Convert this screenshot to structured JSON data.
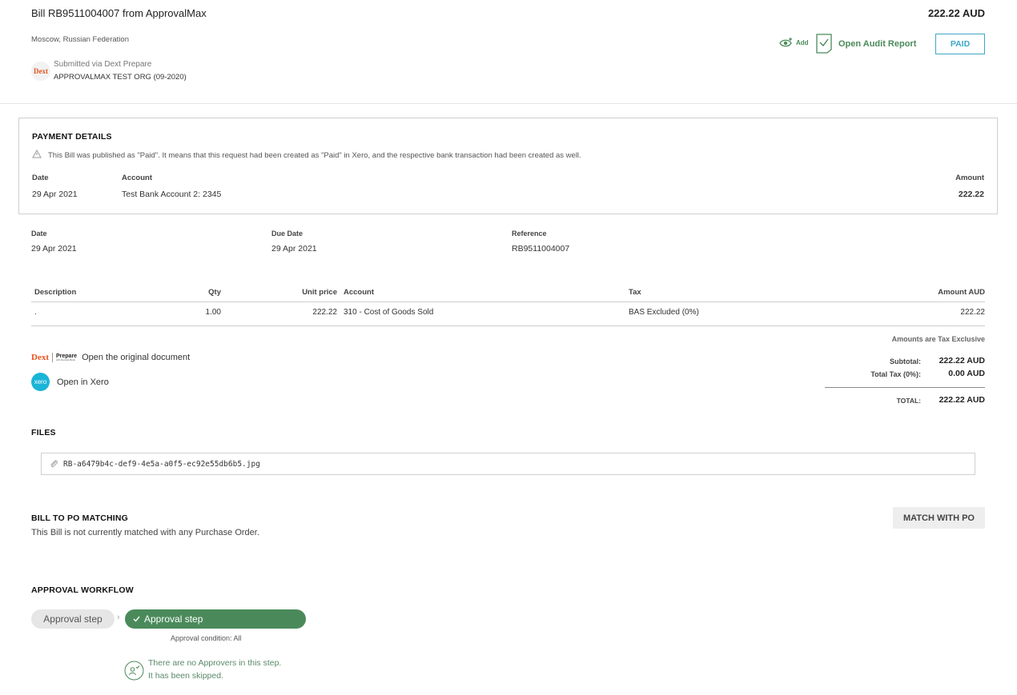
{
  "header": {
    "title": "Bill RB9511004007 from ApprovalMax",
    "total": "222.22 AUD",
    "location": "Moscow, Russian Federation",
    "submitted_via": "Submitted via Dext Prepare",
    "org": "APPROVALMAX TEST ORG (09-2020)",
    "dext_logo_text": "Dext",
    "add_label": "Add",
    "audit_label": "Open Audit Report",
    "status_button": "PAID"
  },
  "payment": {
    "heading": "PAYMENT DETAILS",
    "notice": "This Bill was published as \"Paid\". It means that this request had been created as \"Paid\" in Xero, and the respective bank transaction had been created as well.",
    "date_label": "Date",
    "account_label": "Account",
    "amount_label": "Amount",
    "date": "29 Apr 2021",
    "account": "Test Bank Account 2: 2345",
    "amount": "222.22"
  },
  "details": {
    "date_label": "Date",
    "date": "29 Apr 2021",
    "due_label": "Due Date",
    "due": "29 Apr 2021",
    "ref_label": "Reference",
    "ref": "RB9511004007"
  },
  "table": {
    "headers": [
      "Description",
      "Qty",
      "Unit price",
      "Account",
      "Tax",
      "Amount AUD"
    ],
    "rows": [
      [
        ".",
        "1.00",
        "222.22",
        "310 - Cost of Goods Sold",
        "BAS Excluded (0%)",
        "222.22"
      ]
    ],
    "tax_note": "Amounts are Tax Exclusive"
  },
  "links": {
    "dext_brand": "Dext",
    "prepare_brand": "Prepare",
    "prepare_sub": "with Receipt Bank",
    "open_original": "Open the original document",
    "xero_logo": "xero",
    "open_xero": "Open in Xero"
  },
  "totals": {
    "subtotal_label": "Subtotal:",
    "subtotal": "222.22 AUD",
    "tax_label": "Total Tax (0%):",
    "tax": "0.00 AUD",
    "total_label": "TOTAL:",
    "total": "222.22 AUD"
  },
  "files": {
    "heading": "FILES",
    "file_name": "RB-a6479b4c-def9-4e5a-a0f5-ec92e55db6b5.jpg"
  },
  "po": {
    "heading": "BILL TO PO MATCHING",
    "text": "This Bill is not currently matched with any Purchase Order.",
    "button": "MATCH WITH PO"
  },
  "workflow": {
    "heading": "APPROVAL WORKFLOW",
    "step1": "Approval step",
    "step2": "Approval step",
    "condition": "Approval condition: All",
    "note_line1": "There are no Approvers in this step.",
    "note_line2": "It has been skipped."
  },
  "colors": {
    "accent_green": "#4a8a5a",
    "paid_blue": "#3fa7c8",
    "dext_orange": "#e8531e",
    "xero_blue": "#1ab4d7"
  }
}
